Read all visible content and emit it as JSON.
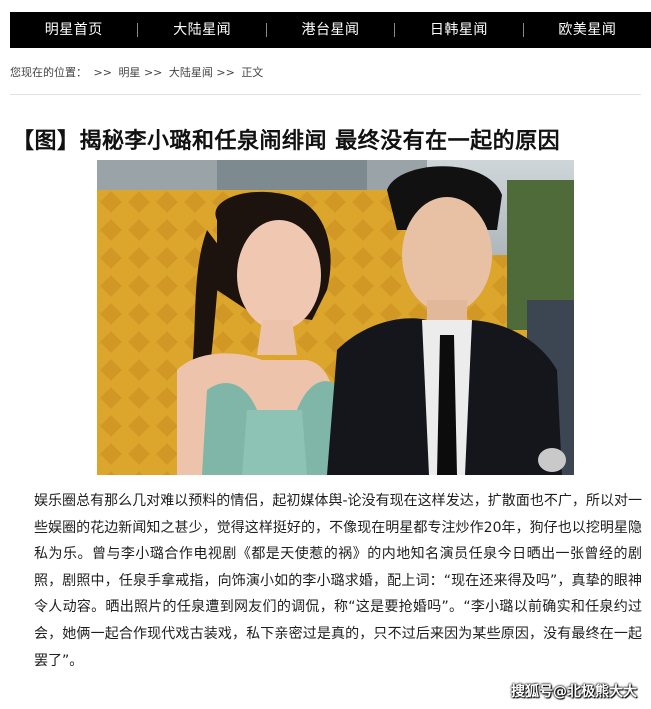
{
  "nav": {
    "items": [
      "明星首页",
      "大陆星闻",
      "港台星闻",
      "日韩星闻",
      "欧美星闻"
    ]
  },
  "breadcrumb": {
    "prefix": "您现在的位置：",
    "sep": ">>",
    "items": [
      "明星",
      "大陆星闻",
      "正文"
    ]
  },
  "article": {
    "title": "【图】揭秘李小璐和任泉闹绯闻 最终没有在一起的原因",
    "body": "娱乐圈总有那么几对难以预料的情侣，起初媒体舆-论没有现在这样发达，扩散面也不广，所以对一些娱圈的花边新闻知之甚少，觉得这样挺好的，不像现在明星都专注炒作20年，狗仔也以挖明星隐私为乐。曾与李小璐合作电视剧《都是天使惹的祸》的内地知名演员任泉今日晒出一张曾经的剧照，剧照中，任泉手拿戒指，向饰演小如的李小璐求婚，配上词：“现在还来得及吗”，真挚的眼神令人动容。晒出照片的任泉遭到网友们的调侃，称“这是要抢婚吗”。“李小璐以前确实和任泉约过会，她俩一起合作现代戏古装戏，私下亲密过是真的，只不过后来因为某些原因，没有最终在一起罢了”。"
  },
  "watermark": "搜狐号@北极熊大大",
  "colors": {
    "nav_bg": "#000000",
    "nav_text": "#ffffff",
    "backdrop": "#d9a42a"
  }
}
